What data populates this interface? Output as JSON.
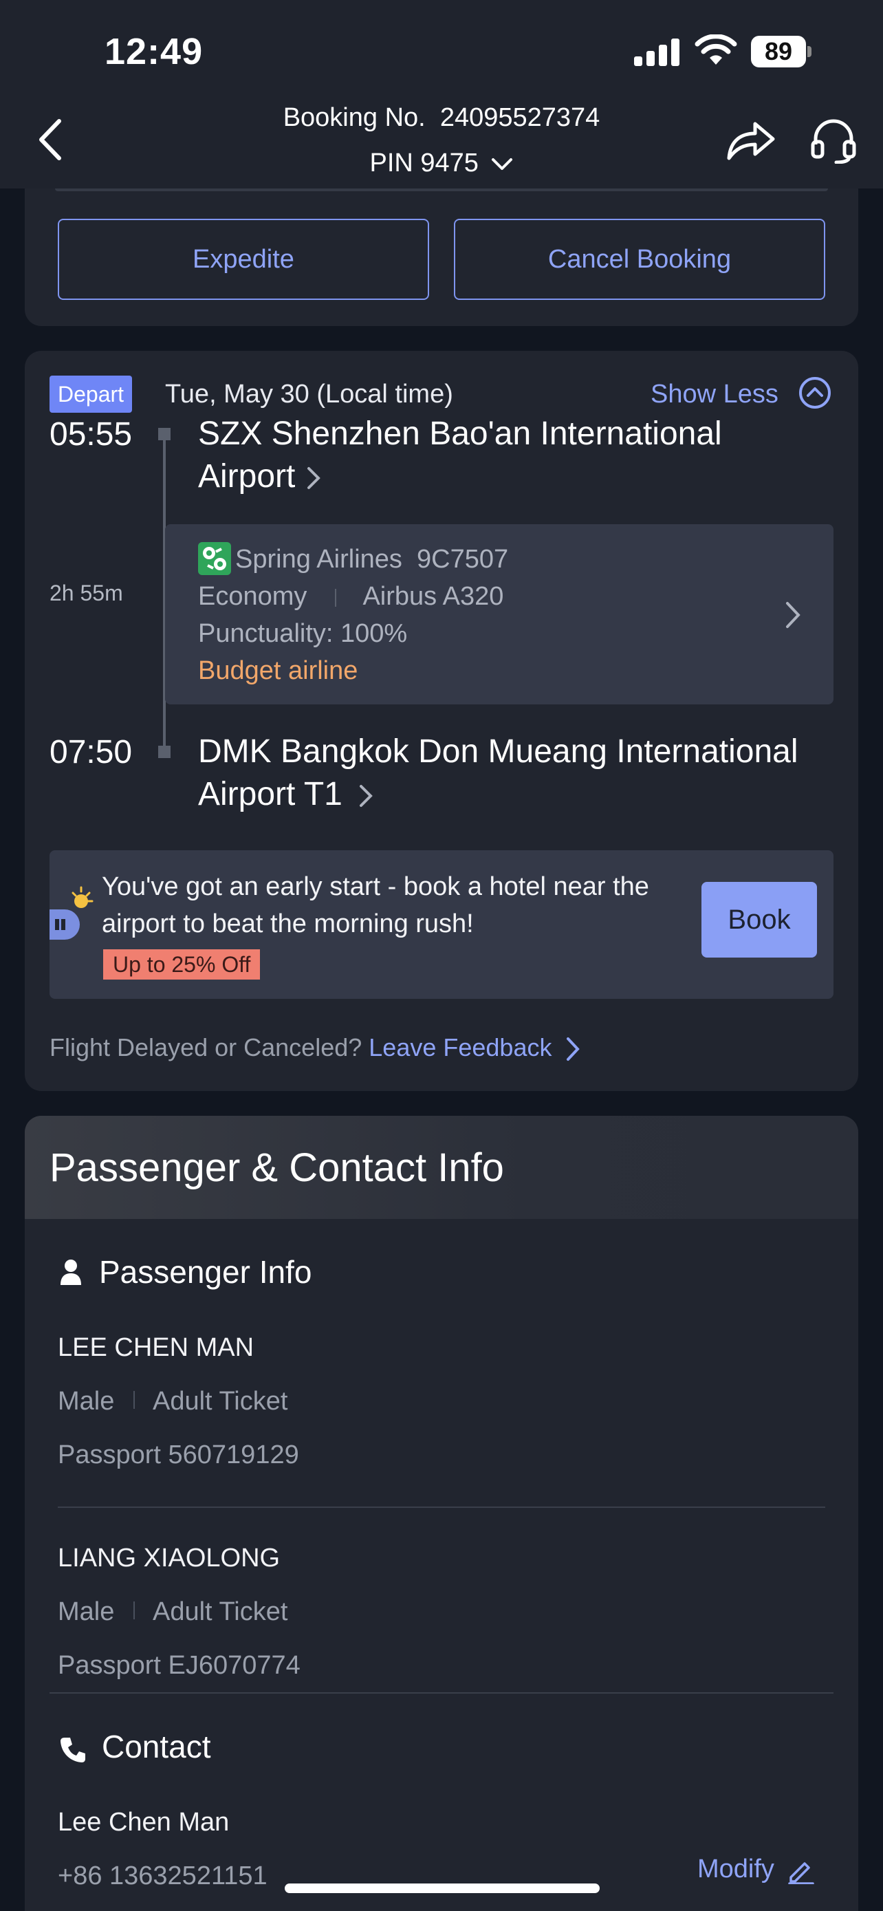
{
  "status_bar": {
    "time": "12:49",
    "battery": "89"
  },
  "header": {
    "booking_label": "Booking No.",
    "booking_number": "24095527374",
    "pin": "PIN 9475"
  },
  "actions": {
    "expedite": "Expedite",
    "cancel": "Cancel Booking"
  },
  "flight": {
    "badge": "Depart",
    "date": "Tue, May 30 (Local time)",
    "toggle": "Show Less",
    "departure": {
      "time": "05:55",
      "airport_line1": "SZX  Shenzhen Bao'an International",
      "airport_line2": "Airport"
    },
    "duration": "2h 55m",
    "airline": "Spring Airlines",
    "flight_no": "9C7507",
    "cabin": "Economy",
    "aircraft": "Airbus A320",
    "punctuality": "Punctuality: 100%",
    "tag": "Budget airline",
    "arrival": {
      "time": "07:50",
      "airport_line1": "DMK  Bangkok Don Mueang International",
      "airport_line2": "Airport T1"
    }
  },
  "promo": {
    "text": "You've got an early start - book a hotel near the airport to beat the morning rush!",
    "badge": "Up to 25% Off",
    "button": "Book"
  },
  "feedback": {
    "question": "Flight Delayed or Canceled?",
    "link": "Leave Feedback"
  },
  "passenger_section": {
    "title": "Passenger & Contact Info",
    "passenger_info_title": "Passenger Info",
    "passengers": [
      {
        "name": "LEE CHEN MAN",
        "gender": "Male",
        "ticket": "Adult Ticket",
        "passport": "Passport 560719129"
      },
      {
        "name": "LIANG XIAOLONG",
        "gender": "Male",
        "ticket": "Adult Ticket",
        "passport": "Passport EJ6070774"
      }
    ],
    "contact_title": "Contact",
    "contact_name": "Lee Chen Man",
    "contact_phone": "+86 13632521151",
    "modify": "Modify"
  },
  "colors": {
    "accent": "#8fa4f7",
    "badge": "#6f86f6",
    "budget": "#f2a76a",
    "promo_badge": "#f07f70"
  }
}
